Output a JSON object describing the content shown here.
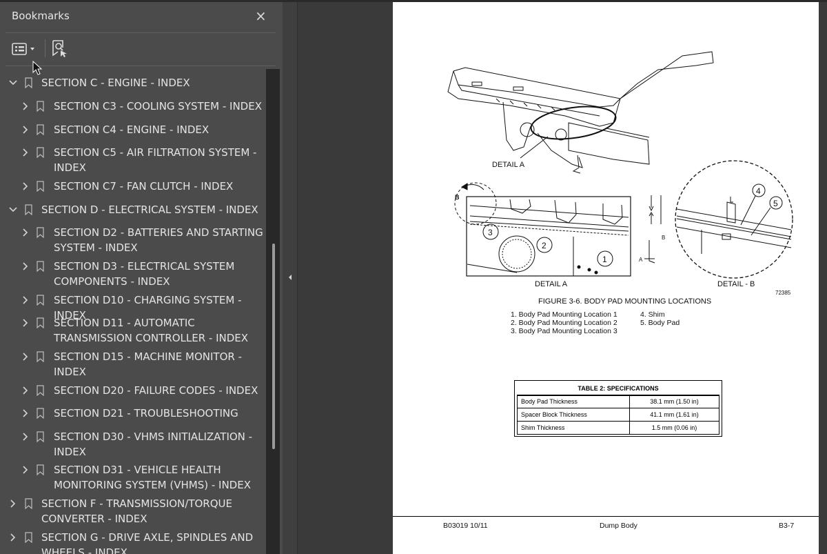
{
  "sidebar": {
    "title": "Bookmarks",
    "close_icon": "×",
    "options_icon": "bookmark-options-icon",
    "find_icon": "find-bookmark-icon",
    "items": [
      {
        "label_lines": [
          "SECTION C - ENGINE  - INDEX"
        ],
        "expanded": true,
        "level": 0
      },
      {
        "label_lines": [
          "SECTION C3 - COOLING SYSTEM - INDEX"
        ],
        "expanded": false,
        "level": 1
      },
      {
        "label_lines": [
          "SECTION C4 - ENGINE - INDEX"
        ],
        "expanded": false,
        "level": 1
      },
      {
        "label_lines": [
          "SECTION C5 - AIR FILTRATION SYSTEM -",
          "INDEX"
        ],
        "expanded": false,
        "level": 1
      },
      {
        "label_lines": [
          "SECTION C7 - FAN CLUTCH - INDEX"
        ],
        "expanded": false,
        "level": 1
      },
      {
        "label_lines": [
          "SECTION D - ELECTRICAL SYSTEM - INDEX"
        ],
        "expanded": true,
        "level": 0
      },
      {
        "label_lines": [
          "SECTION D2 - BATTERIES AND STARTING",
          "SYSTEM - INDEX"
        ],
        "expanded": false,
        "level": 1
      },
      {
        "label_lines": [
          "SECTION D3 - ELECTRICAL SYSTEM",
          "COMPONENTS - INDEX"
        ],
        "expanded": false,
        "level": 1
      },
      {
        "label_lines": [
          "SECTION D10 - CHARGING SYSTEM - INDEX"
        ],
        "expanded": false,
        "level": 1
      },
      {
        "label_lines": [
          "SECTION D11 - AUTOMATIC",
          "TRANSMISSION CONTROLLER - INDEX"
        ],
        "expanded": false,
        "level": 1
      },
      {
        "label_lines": [
          "SECTION D15 - MACHINE MONITOR -",
          "INDEX"
        ],
        "expanded": false,
        "level": 1
      },
      {
        "label_lines": [
          "SECTION D20 - FAILURE CODES - INDEX"
        ],
        "expanded": false,
        "level": 1
      },
      {
        "label_lines": [
          "SECTION D21 -  TROUBLESHOOTING"
        ],
        "expanded": false,
        "level": 1
      },
      {
        "label_lines": [
          "SECTION D30 - VHMS INITIALIZATION -",
          "INDEX"
        ],
        "expanded": false,
        "level": 1
      },
      {
        "label_lines": [
          "SECTION D31 - VEHICLE HEALTH",
          "MONITORING SYSTEM (VHMS) - INDEX"
        ],
        "expanded": false,
        "level": 1
      },
      {
        "label_lines": [
          "SECTION F - TRANSMISSION/TORQUE",
          "CONVERTER - INDEX"
        ],
        "expanded": false,
        "level": 0
      },
      {
        "label_lines": [
          "SECTION G - DRIVE AXLE, SPINDLES AND",
          "WHEELS - INDEX"
        ],
        "expanded": false,
        "level": 0
      }
    ]
  },
  "document": {
    "figure_labels": {
      "detail_a_top": "DETAIL A",
      "detail_a": "DETAIL A",
      "detail_b": "DETAIL - B",
      "figure_number": "72385",
      "b_marker": "B",
      "a_marker": "A",
      "b_small": "B",
      "callouts": [
        "1",
        "2",
        "3",
        "4",
        "5"
      ]
    },
    "caption": "FIGURE 3-6. BODY PAD MOUNTING LOCATIONS",
    "legend_left": [
      "1. Body Pad Mounting Location 1",
      "2. Body Pad Mounting Location 2",
      "3. Body Pad Mounting Location 3"
    ],
    "legend_right": [
      "4. Shim",
      "5. Body Pad"
    ],
    "table": {
      "title": "TABLE 2: SPECIFICATIONS",
      "rows": [
        {
          "name": "Body Pad Thickness",
          "value": "38.1 mm (1.50 in)"
        },
        {
          "name": "Spacer Block Thickness",
          "value": "41.1 mm (1.61 in)"
        },
        {
          "name": "Shim Thickness",
          "value": "1.5 mm (0.06 in)"
        }
      ]
    },
    "footer": {
      "left": "B03019  10/11",
      "center": "Dump Body",
      "right": "B3-7"
    }
  }
}
